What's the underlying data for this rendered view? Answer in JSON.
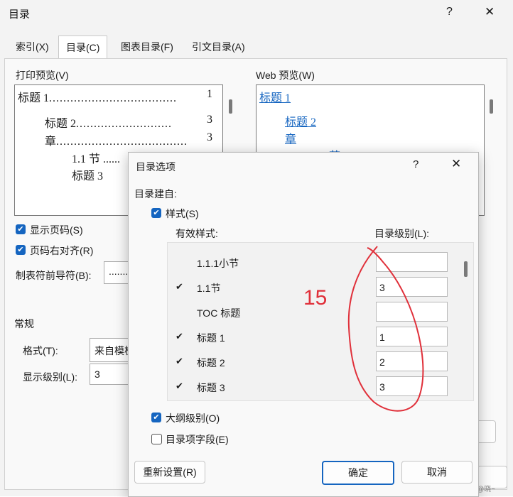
{
  "outer": {
    "title": "目录",
    "help": "?",
    "close": "✕",
    "tabs": [
      "索引(X)",
      "目录(C)",
      "图表目录(F)",
      "引文目录(A)"
    ],
    "print_preview_label": "打印预览(V)",
    "web_preview_label": "Web 预览(W)",
    "print_preview": {
      "line1_text": "标题 1",
      "line1_dots": "....................................",
      "line1_page": "1",
      "line2_text": "标题 2",
      "line2_dots": "...........................",
      "line2_page": "3",
      "line3_text": "章",
      "line3_dots": ".....................................",
      "line3_page": "3",
      "line4_text": "1.1 节",
      "line4_dots": "......",
      "line5_text": "标题 3"
    },
    "web_preview": {
      "line1": "标题 1",
      "line2": "标题 2",
      "line3": "章",
      "line4": "1.1 节"
    },
    "show_page_numbers": "显示页码(S)",
    "right_align": "页码右对齐(R)",
    "tab_leader_label": "制表符前导符(B):",
    "tab_leader_value": ".......",
    "general_heading": "常规",
    "format_label": "格式(T):",
    "format_value": "来自模板",
    "show_levels_label": "显示级别(L):",
    "show_levels_value": "3",
    "side_button": "...",
    "watermark": "CSDN @晓~"
  },
  "dialog": {
    "title": "目录选项",
    "help": "?",
    "close": "✕",
    "build_from": "目录建自:",
    "styles_checkbox": "样式(S)",
    "available_styles_header": "有效样式:",
    "toc_level_header": "目录级别(L):",
    "rows": [
      {
        "name": "1.1.1小节",
        "checked": false,
        "level": ""
      },
      {
        "name": "1.1节",
        "checked": true,
        "level": "3"
      },
      {
        "name": "TOC 标题",
        "checked": false,
        "level": ""
      },
      {
        "name": "标题 1",
        "checked": true,
        "level": "1"
      },
      {
        "name": "标题 2",
        "checked": true,
        "level": "2"
      },
      {
        "name": "标题 3",
        "checked": true,
        "level": "3"
      }
    ],
    "check_glyph": "✔",
    "outline_levels": "大纲级别(O)",
    "toc_entry_fields": "目录项字段(E)",
    "reset_button": "重新设置(R)",
    "ok_button": "确定",
    "cancel_button": "取消"
  },
  "annotation": {
    "text": "15",
    "color": "#e0303a"
  },
  "colors": {
    "accent": "#1565c0",
    "annotation": "#e0303a"
  }
}
